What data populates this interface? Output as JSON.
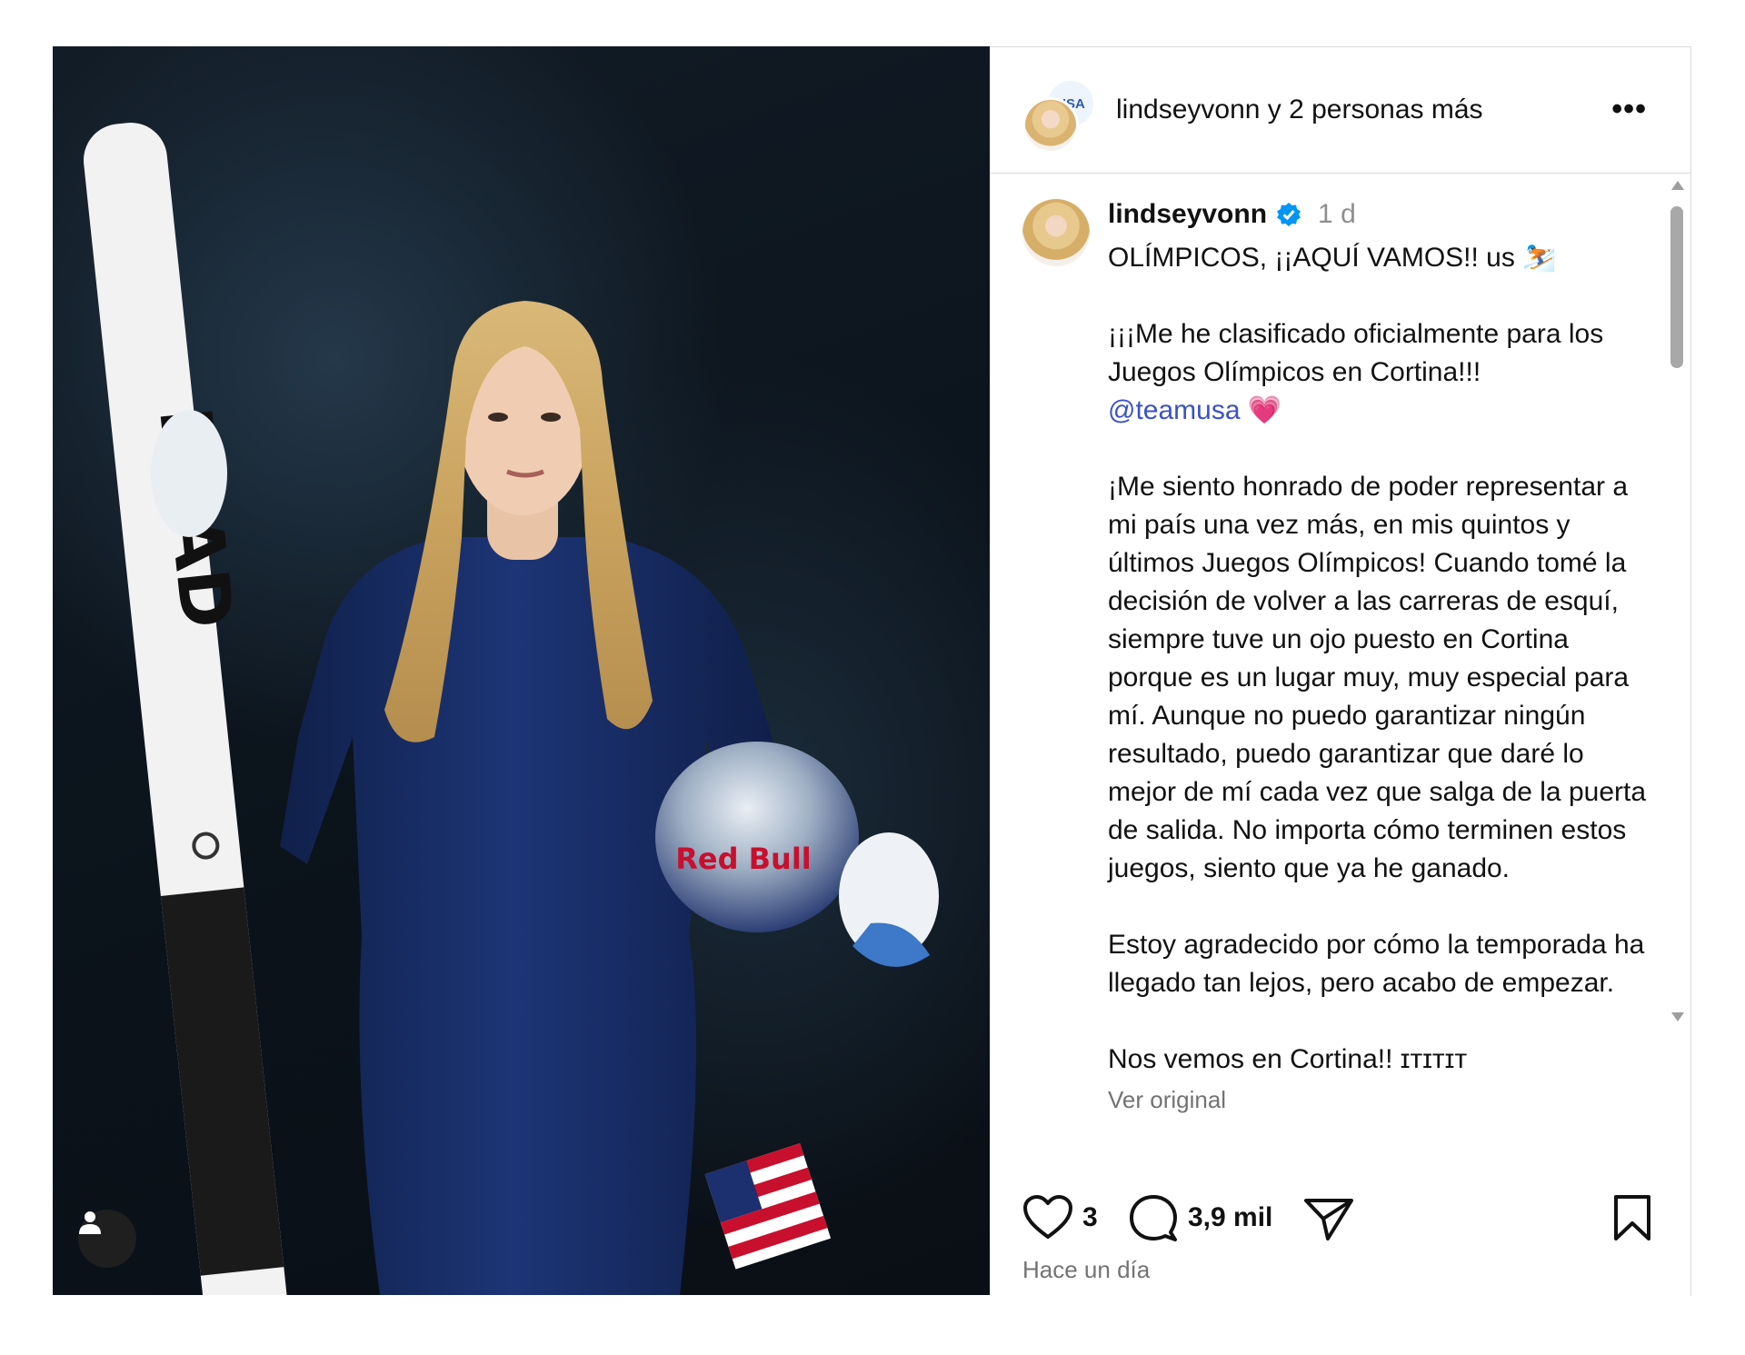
{
  "post": {
    "header": {
      "username": "lindseyvonn",
      "coauthors_text": " y 2 personas más",
      "back_avatar_text": "USA",
      "more_label": "•••"
    },
    "photo": {
      "ski_brand": "HEAD",
      "helmet_brand": "Red Bull"
    },
    "caption": {
      "username": "lindseyvonn",
      "time": "1 d",
      "lines": [
        "OLÍMPICOS, ¡¡AQUÍ VAMOS!! us ⛷️",
        "¡¡¡Me he clasificado oficialmente para los Juegos Olímpicos en Cortina!!!",
        "@teamusa",
        "💗",
        "¡Me siento honrado de poder representar a mi país una vez más, en mis quintos y últimos Juegos Olímpicos! Cuando tomé la decisión de volver a las carreras de esquí, siempre tuve un ojo puesto en Cortina porque es un lugar muy, muy especial para mí. Aunque no puedo garantizar ningún resultado, puedo garantizar que daré lo mejor de mí cada vez que salga de la puerta de salida. No importa cómo terminen estos juegos, siento que ya he ganado.",
        "Estoy agradecido por cómo la temporada ha llegado tan lejos, pero acabo de empezar.",
        "Nos vemos en Cortina!! ɪᴛɪᴛɪᴛ"
      ],
      "see_original": "Ver original"
    },
    "actions": {
      "likes": "3",
      "comments": "3,9 mil"
    },
    "timestamp": "Hace un día"
  },
  "colors": {
    "mention": "#3a52c5",
    "verified": "#0095f6",
    "muted": "#737373",
    "border": "#dbdbdb"
  },
  "icons": [
    "heart-icon",
    "comment-icon",
    "share-icon",
    "bookmark-icon",
    "verified-icon",
    "more-icon",
    "user-tag-icon"
  ]
}
